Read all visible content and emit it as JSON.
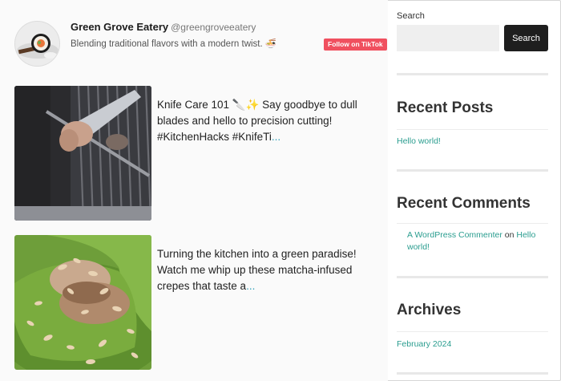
{
  "profile": {
    "name": "Green Grove Eatery",
    "handle": "@greengroveeatery",
    "bio": "Blending traditional flavors with a modern twist. 🍜",
    "follow_label": "Follow on TikTok"
  },
  "videos": [
    {
      "caption": "Knife Care 101 🔪✨ Say goodbye to dull blades and hello to precision cutting! #KitchenHacks #KnifeTi",
      "more": "...",
      "thumbnail": "chef-sharpening-knife"
    },
    {
      "caption": "Turning the kitchen into a green paradise! Watch me whip up these matcha-infused crepes that taste a",
      "more": "...",
      "thumbnail": "matcha-crepe-with-almonds"
    }
  ],
  "sidebar": {
    "search_label": "Search",
    "search_placeholder": "",
    "search_button": "Search",
    "recent_posts_title": "Recent Posts",
    "recent_posts": [
      "Hello world!"
    ],
    "recent_comments_title": "Recent Comments",
    "comment": {
      "author": "A WordPress Commenter",
      "on": "on",
      "post": "Hello world!"
    },
    "archives_title": "Archives",
    "archives": [
      "February 2024"
    ]
  },
  "colors": {
    "accent_link": "#2a9d8f",
    "follow_button": "#f0505f",
    "search_button": "#1e1e1e"
  }
}
